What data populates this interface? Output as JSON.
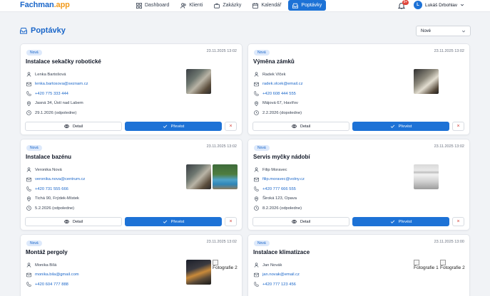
{
  "app": {
    "logo_main": "Fachman",
    "logo_suffix": ".app"
  },
  "nav": {
    "items": [
      {
        "label": "Dashboard",
        "icon": "grid-icon"
      },
      {
        "label": "Klienti",
        "icon": "users-icon"
      },
      {
        "label": "Zakázky",
        "icon": "briefcase-icon"
      },
      {
        "label": "Kalendář",
        "icon": "calendar-icon"
      },
      {
        "label": "Poptávky",
        "icon": "inbox-icon"
      }
    ],
    "active": "Poptávky"
  },
  "notifications": {
    "count": "9+"
  },
  "user": {
    "initial": "L",
    "name": "Lukáš Drbohlav"
  },
  "page": {
    "title": "Poptávky",
    "filter_value": "Nové"
  },
  "actions": {
    "detail": "Detail",
    "convert": "Převést",
    "delete": "×"
  },
  "colors": {
    "brand": "#1d72d6",
    "accent": "#f29b1e",
    "danger": "#d23b32"
  },
  "cards": [
    {
      "badge": "Nová",
      "date": "23.11.2025 13:02",
      "title": "Instalace sekačky robotické",
      "name": "Lenka Bartošová",
      "email": "lenka.bartosova@seznam.cz",
      "phone": "+420 775 333 444",
      "address": "Jasná 34, Ústí nad Labem",
      "when": "29.1.2026 (odpoledne)"
    },
    {
      "badge": "Nová",
      "date": "23.11.2025 13:02",
      "title": "Výměna zámků",
      "name": "Radek Vlček",
      "email": "radek.vlcek@email.cz",
      "phone": "+420 608 444 555",
      "address": "Májová 67, Havířov",
      "when": "2.2.2026 (dopoledne)"
    },
    {
      "badge": "Nová",
      "date": "23.11.2025 13:02",
      "title": "Instalace bazénu",
      "name": "Veronika Nová",
      "email": "veronika.nova@centrum.cz",
      "phone": "+420 731 555 666",
      "address": "Tichá 90, Frýdek-Místek",
      "when": "5.2.2026 (odpoledne)"
    },
    {
      "badge": "Nová",
      "date": "23.11.2025 13:02",
      "title": "Servis myčky nádobí",
      "name": "Filip Moravec",
      "email": "filip.moravec@volny.cz",
      "phone": "+420 777 666 555",
      "address": "Široká 123, Opava",
      "when": "8.2.2026 (odpoledne)"
    },
    {
      "badge": "Nová",
      "date": "23.11.2025 13:02",
      "title": "Montáž pergoly",
      "name": "Monika Bílá",
      "email": "monika.bila@gmail.com",
      "phone": "+420 604 777 888",
      "photo_alt": "Fotografie 2"
    },
    {
      "badge": "Nová",
      "date": "23.11.2025 13:00",
      "title": "Instalace klimatizace",
      "name": "Jan Novák",
      "email": "jan.novak@email.cz",
      "phone": "+420 777 123 456",
      "photo_alt_1": "Fotografie 1",
      "photo_alt_2": "Fotografie 2"
    }
  ]
}
